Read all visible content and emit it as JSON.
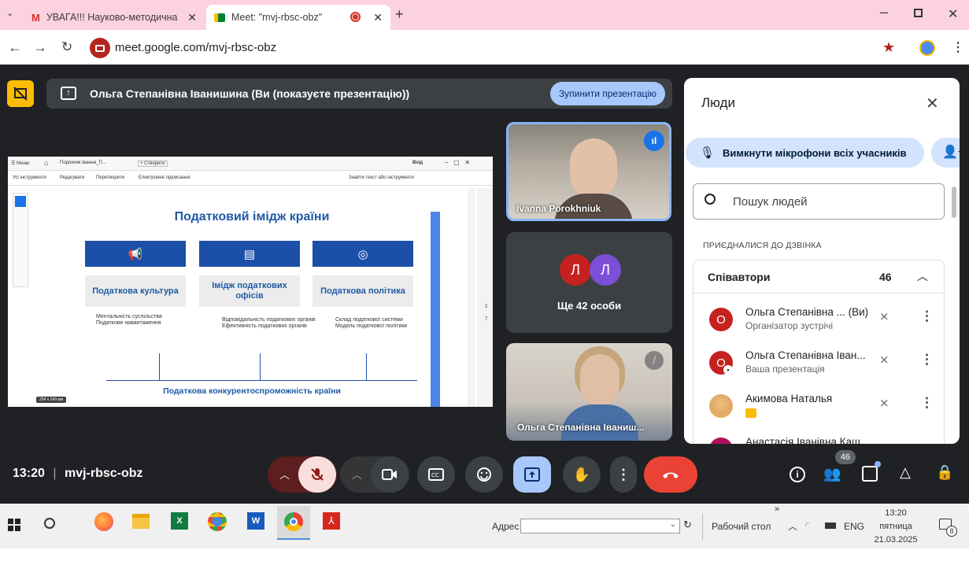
{
  "browser": {
    "tabs": [
      {
        "title": "УВАГА!!! Науково-методична р",
        "active": false
      },
      {
        "title": "Meet: \"mvj-rbsc-obz\"",
        "active": true
      }
    ],
    "url": "meet.google.com/mvj-rbsc-obz"
  },
  "meet": {
    "banner_text": "Ольга Степанівна Іванишина (Ви (показуєте презентацію))",
    "stop_button": "Зупинити презентацію",
    "slide": {
      "menu_items": [
        "☰ Меню",
        "Порохняк Іванна_П...",
        "+ Створити"
      ],
      "exit_label": "Вхід",
      "toolbar_items": [
        "Усі інструменти",
        "Редагувати",
        "Перетворити",
        "Електронне підписання"
      ],
      "search_tools": "Знайти текст або інструменти",
      "title": "Податковий імідж країни",
      "boxes": [
        "Податкова культура",
        "Імідж податкових офісів",
        "Податкова політика"
      ],
      "bullets_1": [
        "Ментальність суспільства",
        "Податкове навантаження"
      ],
      "bullets_2": [
        "Відповідальність податкових органів",
        "Ефективність податкових органів"
      ],
      "bullets_3": [
        "Склад податкової системи",
        "Модель податкової політики"
      ],
      "footer": "Податкова конкурентоспроможність країни",
      "page_size": "254 x 143 мм",
      "page_num": "2",
      "page_total": "7"
    },
    "tiles": [
      {
        "name": "Ivanna Porokhniuk"
      },
      {
        "others_label": "Ще 42 особи",
        "avatars": [
          "Л",
          "Л"
        ]
      },
      {
        "name": "Ольга Степанівна Іваниш..."
      }
    ],
    "people_panel": {
      "title": "Люди",
      "mute_all": "Вимкнути мікрофони всіх учасників",
      "search_placeholder": "Пошук людей",
      "section_label": "ПРИЄДНАЛИСЯ ДО ДЗВІНКА",
      "group_label": "Співавтори",
      "group_count": "46",
      "participants": [
        {
          "initial": "О",
          "name": "Ольга Степанівна ... (Ви)",
          "sub": "Організатор зустрічі"
        },
        {
          "initial": "О",
          "name": "Ольга Степанівна Іван...",
          "sub": "Ваша презентація"
        },
        {
          "initial": "",
          "name": "Акимова Наталья",
          "sub": ""
        },
        {
          "initial": "",
          "name": "Анастасія Іванівна Каш...",
          "sub": ""
        }
      ]
    },
    "controls": {
      "time": "13:20",
      "meeting_code": "mvj-rbsc-obz",
      "people_badge": "46"
    }
  },
  "taskbar": {
    "address_label": "Адрес",
    "desktop_label": "Рабочий стол",
    "lang": "ENG",
    "time": "13:20",
    "weekday": "пятница",
    "date": "21.03.2025",
    "notif_count": "8"
  },
  "colors": {
    "tabbar": "#fbd2dd",
    "meet_bg": "#202124",
    "end_call": "#ea4335",
    "accent_blue": "#a8c7fa",
    "slide_blue": "#1b4fa8"
  }
}
